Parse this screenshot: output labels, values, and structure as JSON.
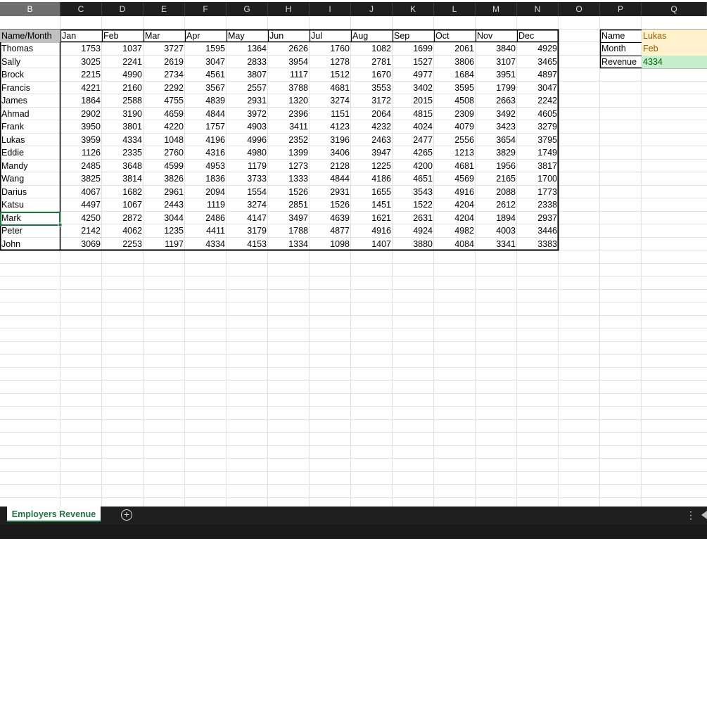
{
  "columns": [
    "B",
    "C",
    "D",
    "E",
    "F",
    "G",
    "H",
    "I",
    "J",
    "K",
    "L",
    "M",
    "N",
    "O",
    "P",
    "Q"
  ],
  "selected_column": "B",
  "table": {
    "header": [
      "Name/Month",
      "Jan",
      "Feb",
      "Mar",
      "Apr",
      "May",
      "Jun",
      "Jul",
      "Aug",
      "Sep",
      "Oct",
      "Nov",
      "Dec"
    ],
    "rows": [
      [
        "Thomas",
        "1753",
        "1037",
        "3727",
        "1595",
        "1364",
        "2626",
        "1760",
        "1082",
        "1699",
        "2061",
        "3840",
        "4929"
      ],
      [
        "Sally",
        "3025",
        "2241",
        "2619",
        "3047",
        "2833",
        "3954",
        "1278",
        "2781",
        "1527",
        "3806",
        "3107",
        "3465"
      ],
      [
        "Brock",
        "2215",
        "4990",
        "2734",
        "4561",
        "3807",
        "1117",
        "1512",
        "1670",
        "4977",
        "1684",
        "3951",
        "4897"
      ],
      [
        "Francis",
        "4221",
        "2160",
        "2292",
        "3567",
        "2557",
        "3788",
        "4681",
        "3553",
        "3402",
        "3595",
        "1799",
        "3047"
      ],
      [
        "James",
        "1864",
        "2588",
        "4755",
        "4839",
        "2931",
        "1320",
        "3274",
        "3172",
        "2015",
        "4508",
        "2663",
        "2242"
      ],
      [
        "Ahmad",
        "2902",
        "3190",
        "4659",
        "4844",
        "3972",
        "2396",
        "1151",
        "2064",
        "4815",
        "2309",
        "3492",
        "4605"
      ],
      [
        "Frank",
        "3950",
        "3801",
        "4220",
        "1757",
        "4903",
        "3411",
        "4123",
        "4232",
        "4024",
        "4079",
        "3423",
        "3279"
      ],
      [
        "Lukas",
        "3959",
        "4334",
        "1048",
        "4196",
        "4996",
        "2352",
        "3196",
        "2463",
        "2477",
        "2556",
        "3654",
        "3795"
      ],
      [
        "Eddie",
        "1126",
        "2335",
        "2760",
        "4316",
        "4980",
        "1399",
        "3406",
        "3947",
        "4265",
        "1213",
        "3829",
        "1749"
      ],
      [
        "Mandy",
        "2485",
        "3648",
        "4599",
        "4953",
        "1179",
        "1273",
        "2128",
        "1225",
        "4200",
        "4681",
        "1956",
        "3817"
      ],
      [
        "Wang",
        "3825",
        "3814",
        "3826",
        "1836",
        "3733",
        "1333",
        "4844",
        "4186",
        "4651",
        "4569",
        "2165",
        "1700"
      ],
      [
        "Darius",
        "4067",
        "1682",
        "2961",
        "2094",
        "1554",
        "1526",
        "2931",
        "1655",
        "3543",
        "4916",
        "2088",
        "1773"
      ],
      [
        "Katsu",
        "4497",
        "1067",
        "2443",
        "1119",
        "3274",
        "2851",
        "1526",
        "1451",
        "1522",
        "4204",
        "2612",
        "2338"
      ],
      [
        "Mark",
        "4250",
        "2872",
        "3044",
        "2486",
        "4147",
        "3497",
        "4639",
        "1621",
        "2631",
        "4204",
        "1894",
        "2937"
      ],
      [
        "Peter",
        "2142",
        "4062",
        "1235",
        "4411",
        "3179",
        "1788",
        "4877",
        "4916",
        "4924",
        "4982",
        "4003",
        "3446"
      ],
      [
        "John",
        "3069",
        "2253",
        "1197",
        "4334",
        "4153",
        "1334",
        "1098",
        "1407",
        "3880",
        "4084",
        "3341",
        "3383"
      ]
    ]
  },
  "lookup": {
    "name_label": "Name",
    "name_value": "Lukas",
    "month_label": "Month",
    "month_value": "Feb",
    "revenue_label": "Revenue",
    "revenue_value": "4334"
  },
  "sheet_tab": "Employers Revenue",
  "colors": {
    "header_fill": "#c0c0c0",
    "input_fill": "#fff2cc",
    "input_text": "#9c5700",
    "output_fill": "#c6efce",
    "output_text": "#006100",
    "accent": "#217346"
  },
  "icons": {
    "add_sheet": "plus-circle-icon",
    "more": "vertical-ellipsis-icon",
    "scroll": "scroll-left-icon"
  }
}
